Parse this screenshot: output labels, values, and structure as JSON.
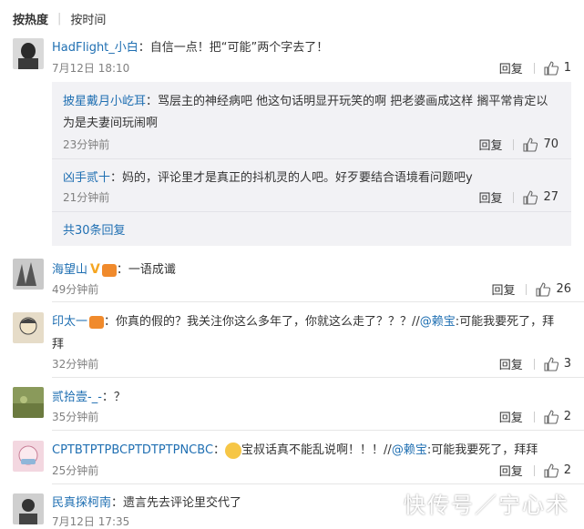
{
  "sort": {
    "hot": "按热度",
    "time": "按时间"
  },
  "colors": {
    "username": "#eb7350",
    "link": "#1f6fb2",
    "muted": "#808080"
  },
  "comments": [
    {
      "user": "HadFlight_小白",
      "text": "：自信一点！把“可能”两个字去了！",
      "time": "7月12日 18:10",
      "reply": "回复",
      "likes": "1"
    },
    {
      "user": "海望山",
      "text": "：一语成谶",
      "time": "49分钟前",
      "reply": "回复",
      "likes": "26"
    },
    {
      "user": "印太一",
      "text": "：你真的假的？我关注你这么多年了，你就这么走了？？？//",
      "mention": "@赖宝",
      "text2": ":可能我要死了，拜",
      "text3": "拜",
      "time": "32分钟前",
      "reply": "回复",
      "likes": "3"
    },
    {
      "user": "贰拾壹-_-",
      "text": "：？",
      "time": "35分钟前",
      "reply": "回复",
      "likes": "2"
    },
    {
      "user": "CPTBTPTPBCPTDTPTPNCBC",
      "text": "：",
      "text_after": "宝叔话真不能乱说啊！！！//",
      "mention": "@赖宝",
      "text2": ":可能我要死了，拜拜",
      "time": "25分钟前",
      "reply": "回复",
      "likes": "2"
    },
    {
      "user": "民真探柯南",
      "text": "：遗言先去评论里交代了",
      "time": "7月12日 17:35"
    }
  ],
  "replies": [
    {
      "user": "披星戴月小屹耳",
      "text": "：骂层主的神经病吧 他这句话明显开玩笑的啊 把老婆画成这样 搁平常肯定以",
      "text_line2": "为是夫妻间玩闹啊",
      "time": "23分钟前",
      "reply": "回复",
      "likes": "70"
    },
    {
      "user": "凶手贰十",
      "text": "：妈的，评论里才是真正的抖机灵的人吧。好歹要结合语境看问题吧y",
      "time": "21分钟前",
      "reply": "回复",
      "likes": "27"
    }
  ],
  "more_replies": "共30条回复",
  "watermark": "快传号／宁心术",
  "icons": {
    "like": "thumb-up-icon",
    "verified": "v-badge-icon",
    "emoji": "smile-emoji-icon"
  }
}
